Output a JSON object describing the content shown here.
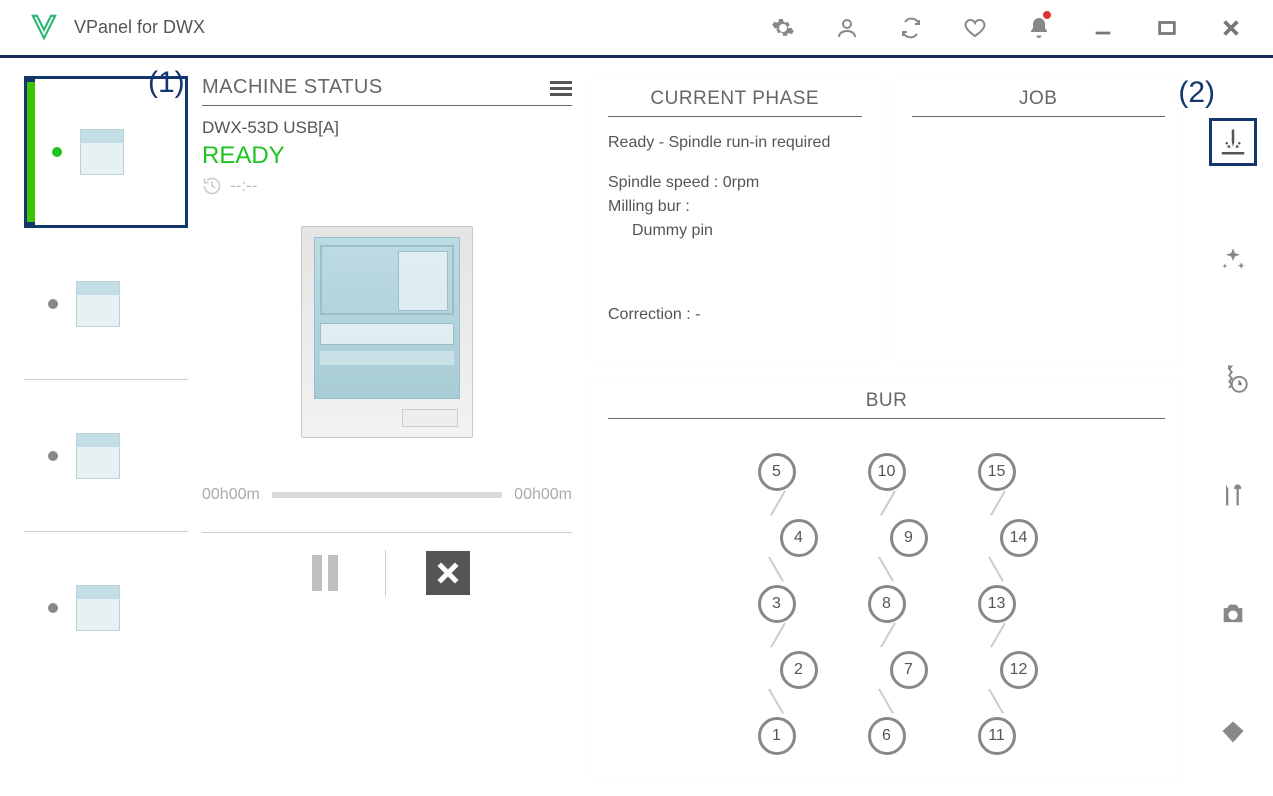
{
  "app": {
    "title": "VPanel for DWX"
  },
  "annotations": {
    "one": "(1)",
    "two": "(2)"
  },
  "status_panel": {
    "heading": "MACHINE STATUS",
    "machine_name": "DWX-53D USB[A]",
    "state": "READY",
    "time_placeholder": "--:--",
    "progress_start": "00h00m",
    "progress_end": "00h00m"
  },
  "current_phase": {
    "heading": "CURRENT PHASE",
    "status_line": "Ready - Spindle run-in required",
    "spindle_label": "Spindle speed : ",
    "spindle_value": "0rpm",
    "bur_label": "Milling bur :",
    "bur_value": "Dummy pin",
    "correction_label": "Correction : ",
    "correction_value": "-"
  },
  "job": {
    "heading": "JOB"
  },
  "bur": {
    "heading": "BUR",
    "cols": [
      [
        "5",
        "4",
        "3",
        "2",
        "1"
      ],
      [
        "10",
        "9",
        "8",
        "7",
        "6"
      ],
      [
        "15",
        "14",
        "13",
        "12",
        "11"
      ]
    ]
  },
  "icons": {
    "settings": "gear-icon",
    "user": "user-icon",
    "refresh": "refresh-icon",
    "heart": "heart-icon",
    "bell": "bell-icon",
    "minimize": "minimize-icon",
    "maximize": "maximize-icon",
    "close": "close-icon",
    "menu": "menu-icon",
    "history": "history-clock-icon"
  }
}
